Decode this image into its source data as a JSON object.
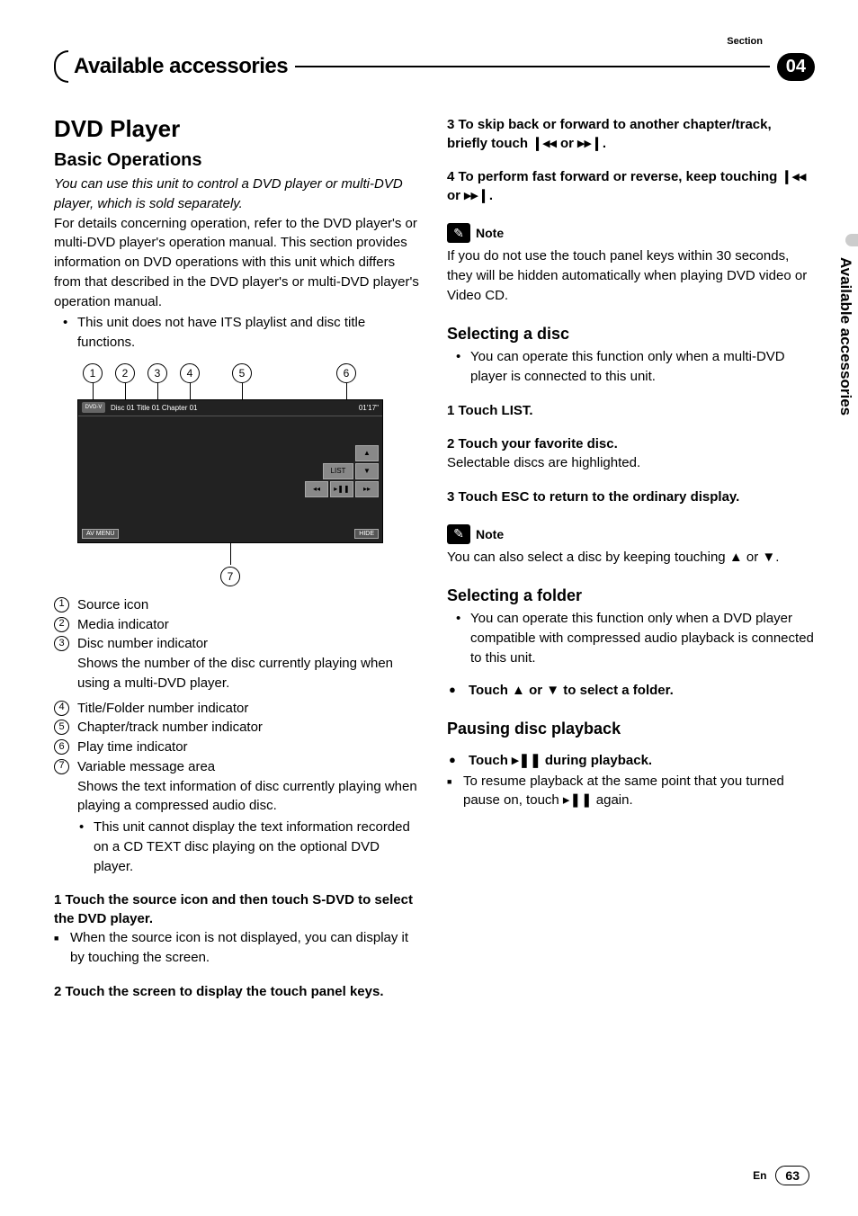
{
  "header": {
    "section_label": "Section",
    "chapter_title": "Available accessories",
    "section_number": "04"
  },
  "side_tab": "Available accessories",
  "left": {
    "h1": "DVD Player",
    "h2": "Basic Operations",
    "intro_italic": "You can use this unit to control a DVD player or multi-DVD player, which is sold separately.",
    "intro_body": "For details concerning operation, refer to the DVD player's or multi-DVD player's operation manual. This section provides information on DVD operations with this unit which differs from that described in the DVD player's or multi-DVD player's operation manual.",
    "intro_bullet": "This unit does not have ITS playlist and disc title functions.",
    "figure": {
      "callouts_top": [
        "1",
        "2",
        "3",
        "4",
        "5",
        "6"
      ],
      "callout_bottom": "7",
      "src_icon": "DVD-V",
      "info_line": "Disc 01  Title 01  Chapter  01",
      "time": "01'17\"",
      "btn_list": "LIST",
      "btn_up": "▲",
      "btn_down": "▼",
      "btn_prev": "◂◂",
      "btn_play": "▸❚❚",
      "btn_next": "▸▸",
      "av_menu": "AV MENU",
      "hide": "HIDE"
    },
    "legend": [
      {
        "n": "1",
        "label": "Source icon"
      },
      {
        "n": "2",
        "label": "Media indicator"
      },
      {
        "n": "3",
        "label": "Disc number indicator",
        "desc": "Shows the number of the disc currently playing when using a multi-DVD player."
      },
      {
        "n": "4",
        "label": "Title/Folder number indicator"
      },
      {
        "n": "5",
        "label": "Chapter/track number indicator"
      },
      {
        "n": "6",
        "label": "Play time indicator"
      },
      {
        "n": "7",
        "label": "Variable message area",
        "desc": "Shows the text information of disc currently playing when playing a compressed audio disc.",
        "sub": "This unit cannot display the text information recorded on a CD TEXT disc playing on the optional DVD player."
      }
    ],
    "step1": "1    Touch the source icon and then touch S-DVD to select the DVD player.",
    "step1_follow": "When the source icon is not displayed, you can display it by touching the screen.",
    "step2": "2    Touch the screen to display the touch panel keys."
  },
  "right": {
    "step3_a": "3    To skip back or forward to another chapter/track, briefly touch ",
    "step3_sym1": "❙◂◂",
    "step3_mid": " or ",
    "step3_sym2": "▸▸❙",
    "step3_end": ".",
    "step4_a": "4    To perform fast forward or reverse, keep touching ",
    "note_label": "Note",
    "note1_body": "If you do not use the touch panel keys within 30 seconds, they will be hidden automatically when playing DVD video or Video CD.",
    "sel_disc_h": "Selecting a disc",
    "sel_disc_bullet": "You can operate this function only when a multi-DVD player is connected to this unit.",
    "sel_disc_s1": "1    Touch LIST.",
    "sel_disc_s2": "2    Touch your favorite disc.",
    "sel_disc_s2_body": "Selectable discs are highlighted.",
    "sel_disc_s3": "3    Touch ESC to return to the ordinary display.",
    "note2_a": "You can also select a disc by keeping touching ",
    "note2_sym1": "▲",
    "note2_mid": " or ",
    "note2_sym2": "▼",
    "note2_end": ".",
    "sel_folder_h": "Selecting a folder",
    "sel_folder_bullet": "You can operate this function only when a DVD player compatible with compressed audio playback is connected to this unit.",
    "sel_folder_action_a": "Touch ",
    "sel_folder_action_sym1": "▲",
    "sel_folder_action_mid": " or ",
    "sel_folder_action_sym2": "▼",
    "sel_folder_action_end": " to select a folder.",
    "pause_h": "Pausing disc playback",
    "pause_action_a": "Touch ",
    "pause_action_sym": "▸❚❚",
    "pause_action_end": " during playback.",
    "pause_follow_a": "To resume playback at the same point that you turned pause on, touch ",
    "pause_follow_sym": "▸❚❚",
    "pause_follow_end": " again."
  },
  "footer": {
    "lang": "En",
    "page": "63"
  }
}
